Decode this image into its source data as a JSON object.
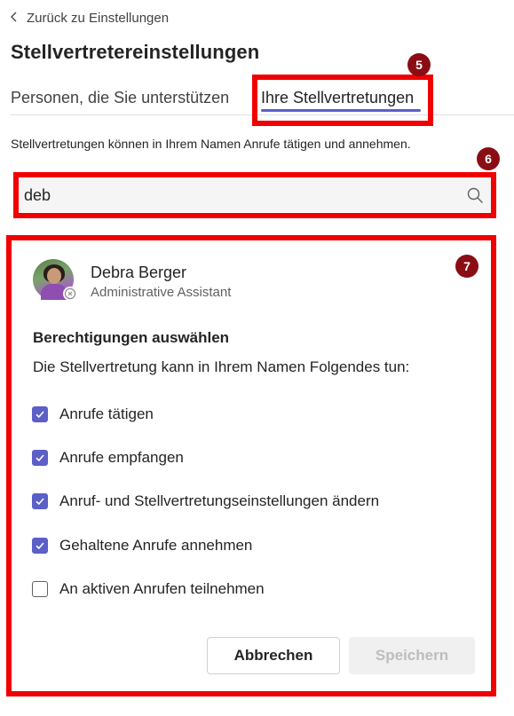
{
  "back_link": {
    "label": "Zurück zu Einstellungen",
    "icon": "chevron-left-icon"
  },
  "page_title": "Stellvertretereinstellungen",
  "tabs": [
    {
      "label": "Personen, die Sie unterstützen",
      "selected": false
    },
    {
      "label": "Ihre Stellvertretungen",
      "selected": true
    }
  ],
  "annotations": {
    "badge_5": "5",
    "badge_6": "6",
    "badge_7": "7",
    "color": "#f00000",
    "badge_color": "#8a0d14"
  },
  "description": "Stellvertretungen können in Ihrem Namen Anrufe tätigen und annehmen.",
  "search": {
    "value": "deb",
    "icon": "search-icon"
  },
  "person": {
    "name": "Debra Berger",
    "role": "Administrative Assistant",
    "presence_icon": "offline-status-icon"
  },
  "permissions": {
    "title": "Berechtigungen auswählen",
    "description": "Die Stellvertretung kann in Ihrem Namen Folgendes tun:",
    "options": [
      {
        "label": "Anrufe tätigen",
        "checked": true
      },
      {
        "label": "Anrufe empfangen",
        "checked": true
      },
      {
        "label": "Anruf- und Stellvertretungseinstellungen ändern",
        "checked": true
      },
      {
        "label": "Gehaltene Anrufe annehmen",
        "checked": true
      },
      {
        "label": "An aktiven Anrufen teilnehmen",
        "checked": false
      }
    ]
  },
  "buttons": {
    "cancel": "Abbrechen",
    "save": "Speichern",
    "save_enabled": false
  },
  "colors": {
    "accent": "#5b5fc7",
    "text": "#242424",
    "muted": "#616161"
  }
}
